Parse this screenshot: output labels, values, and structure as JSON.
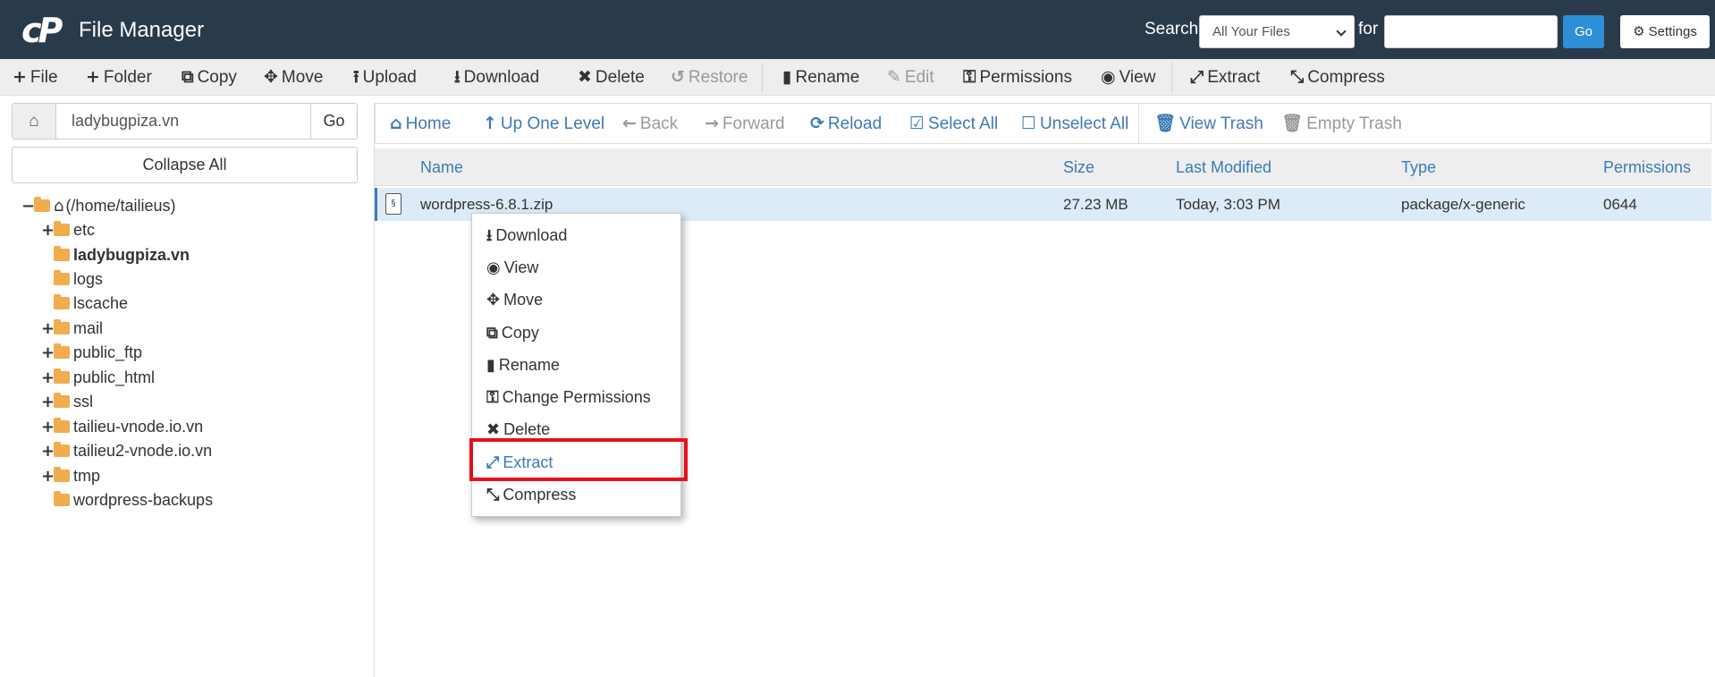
{
  "header": {
    "logo": "cP",
    "title": "File Manager",
    "search_label": "Search",
    "search_scope": "All Your Files",
    "for_label": "for",
    "search_value": "",
    "go_label": "Go",
    "settings_label": "Settings"
  },
  "toolbar": {
    "file": "File",
    "folder": "Folder",
    "copy": "Copy",
    "move": "Move",
    "upload": "Upload",
    "download": "Download",
    "delete": "Delete",
    "restore": "Restore",
    "rename": "Rename",
    "edit": "Edit",
    "permissions": "Permissions",
    "view": "View",
    "extract": "Extract",
    "compress": "Compress"
  },
  "sidebar": {
    "path_value": "ladybugpiza.vn",
    "go_label": "Go",
    "collapse_label": "Collapse All",
    "root": "(/home/tailieus)",
    "items": [
      {
        "label": "etc",
        "toggle": "+"
      },
      {
        "label": "ladybugpiza.vn",
        "toggle": ""
      },
      {
        "label": "logs",
        "toggle": ""
      },
      {
        "label": "lscache",
        "toggle": ""
      },
      {
        "label": "mail",
        "toggle": "+"
      },
      {
        "label": "public_ftp",
        "toggle": "+"
      },
      {
        "label": "public_html",
        "toggle": "+"
      },
      {
        "label": "ssl",
        "toggle": "+"
      },
      {
        "label": "tailieu-vnode.io.vn",
        "toggle": "+"
      },
      {
        "label": "tailieu2-vnode.io.vn",
        "toggle": "+"
      },
      {
        "label": "tmp",
        "toggle": "+"
      },
      {
        "label": "wordpress-backups",
        "toggle": ""
      }
    ]
  },
  "nav": {
    "home": "Home",
    "up": "Up One Level",
    "back": "Back",
    "forward": "Forward",
    "reload": "Reload",
    "select_all": "Select All",
    "unselect_all": "Unselect All",
    "view_trash": "View Trash",
    "empty_trash": "Empty Trash"
  },
  "table": {
    "columns": [
      "Name",
      "Size",
      "Last Modified",
      "Type",
      "Permissions"
    ],
    "rows": [
      {
        "name": "wordpress-6.8.1.zip",
        "size": "27.23 MB",
        "modified": "Today, 3:03 PM",
        "type": "package/x-generic",
        "perms": "0644"
      }
    ]
  },
  "context_menu": {
    "items": [
      "Download",
      "View",
      "Move",
      "Copy",
      "Rename",
      "Change Permissions",
      "Delete",
      "Extract",
      "Compress"
    ],
    "highlighted": "Extract"
  },
  "colors": {
    "header_bg": "#293a4a",
    "link": "#3d7ab8",
    "folder": "#f0ad4e",
    "highlight": "#e8101a",
    "selected_row": "#dcebf7"
  }
}
